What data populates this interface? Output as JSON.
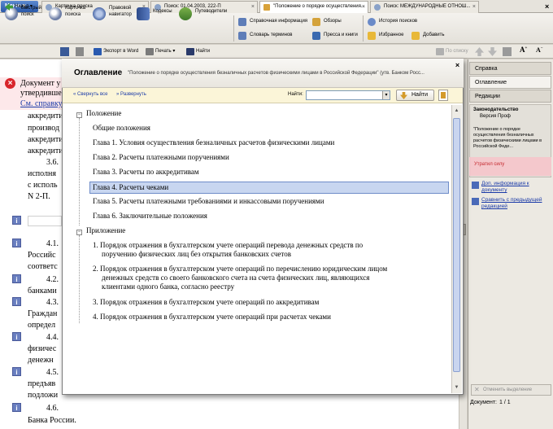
{
  "tabs": {
    "menu_label": "Меню",
    "items": [
      {
        "label": "Карточка поиска"
      },
      {
        "label": "Поиск: 01.04.2003, 222-П"
      },
      {
        "label": "\"Положение о порядке осуществления..."
      },
      {
        "label": "Поиск: МЕЖДУНАРОДНЫЕ ОТНОШ..."
      }
    ]
  },
  "toolbar1": {
    "quick_search": "Быстрый поиск",
    "search_card": "Карточка поиска",
    "legal_navigator": "Правовой навигатор",
    "codes": "Кодексы",
    "guides": "Путеводители",
    "reference": "Справочная информация",
    "dictionary": "Словарь терминов",
    "reviews": "Обзоры",
    "press": "Пресса и книги",
    "history": "История поисков",
    "favorites": "Избранное",
    "add": "Добавить"
  },
  "toolbar2": {
    "back": "Назад",
    "export_word": "Экспорт в Word",
    "print": "Печать",
    "find": "Найти",
    "by_list": "По списку"
  },
  "document": {
    "warn_line1": "Документ у",
    "warn_line2": "утвердивше",
    "warn_link": "См. справку",
    "lines": [
      "аккредити",
      "производ",
      "аккредити",
      "аккредити",
      "3.6.",
      "исполня",
      "с исполь",
      "N 2-П.",
      "4.1.",
      "Российс",
      "соответс",
      "4.2.",
      "банками",
      "4.3.",
      "Граждан",
      "определ",
      "4.4.",
      "физичес",
      "денежн",
      "4.5.",
      "предъяв",
      "подложи",
      "4.6.",
      "Банка России."
    ]
  },
  "right_panel": {
    "tab_help": "Справка",
    "tab_toc": "Оглавление",
    "tab_editions": "Редакции",
    "legislation": "Законодательство",
    "version": "Версия Проф",
    "doc_title": "\"Положение о порядке осуществления безналичных расчетов физическими лицами в Российской Феде...",
    "status": "Утратил силу",
    "link_info": "Доп. информация к документу",
    "link_compare": "Сравнить с предыдущей редакцией",
    "cancel_selection": "Отменить выделение",
    "doc_label": "Документ:",
    "doc_count": "1 / 1"
  },
  "modal": {
    "title": "Оглавление",
    "subtitle": "\"Положение о порядке осуществления безналичных расчетов физическими лицами в Российской Федерации\" (утв. Банком Росс...",
    "collapse_all": "Свернуть все",
    "expand_all": "Развернуть",
    "find_label": "Найти:",
    "find_button": "Найти",
    "section1": "Положение",
    "items1": [
      "Общие положения",
      "Глава 1. Условия осуществления безналичных расчетов физическими лицами",
      "Глава 2. Расчеты платежными поручениями",
      "Глава 3. Расчеты по аккредитивам",
      "Глава 4. Расчеты чеками",
      "Глава 5. Расчеты платежными требованиями и инкассовыми поручениями",
      "Глава 6. Заключительные положения"
    ],
    "section2": "Приложение",
    "app1_l1": "1. Порядок отражения в бухгалтерском учете операций перевода денежных средств по",
    "app1_l2": "поручению физических лиц без открытия банковских счетов",
    "app2_l1": "2. Порядок отражения в бухгалтерском учете операций по перечислению юридическим лицом",
    "app2_l2": "денежных средств со своего банковского счета на счета физических лиц, являющихся",
    "app2_l3": "клиентами одного банка, согласно реестру",
    "app3": "3. Порядок отражения в бухгалтерском учете операций по аккредитивам",
    "app4": "4. Порядок отражения в бухгалтерском учете операций при расчетах чеками"
  }
}
